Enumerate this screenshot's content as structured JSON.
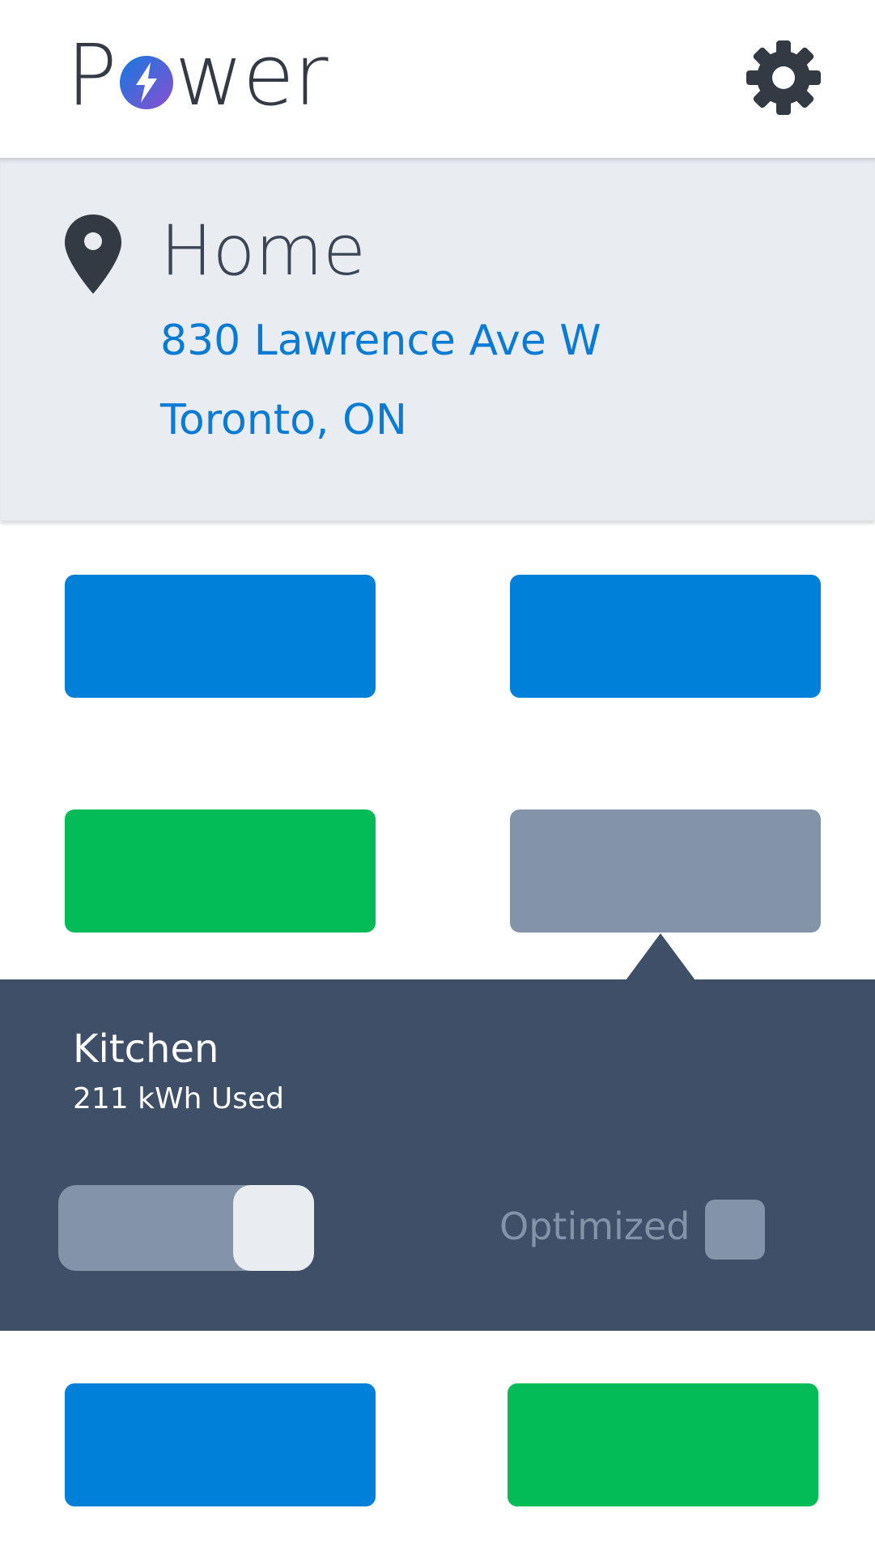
{
  "header": {
    "logo_prefix": "P",
    "logo_suffix": "wer",
    "logo_icon": "lightning-circle-icon",
    "settings_icon": "gear-icon"
  },
  "location": {
    "icon": "map-pin-icon",
    "title": "Home",
    "address_line1": "830 Lawrence Ave W",
    "address_line2": "Toronto, ON"
  },
  "tiles": [
    {
      "status": "blue"
    },
    {
      "status": "blue"
    },
    {
      "status": "green"
    },
    {
      "status": "gray",
      "selected": true
    },
    {
      "status": "blue"
    },
    {
      "status": "green"
    }
  ],
  "detail": {
    "name": "Kitchen",
    "usage": "211 kWh Used",
    "toggle_on": true,
    "optimized_label": "Optimized",
    "optimized_checked": false
  },
  "colors": {
    "accent_blue": "#0080d8",
    "green": "#03bc58",
    "gray": "#8393a8",
    "dark_panel": "#3e4f67",
    "light_panel": "#e9edf2"
  }
}
